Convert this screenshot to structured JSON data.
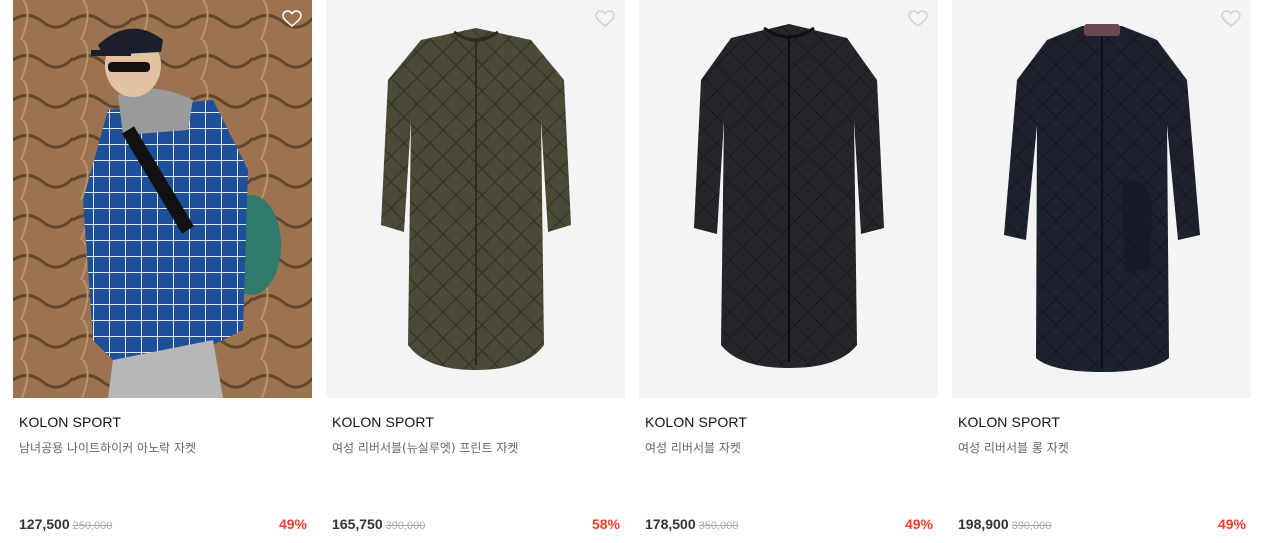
{
  "products": [
    {
      "brand": "KOLON SPORT",
      "name": "남녀공용 나이트하이커 아노락 자켓",
      "price": "127,500",
      "original_price": "250,000",
      "discount": "49%",
      "image": "model-photo",
      "wishlist_icon": "heart-outline-icon"
    },
    {
      "brand": "KOLON SPORT",
      "name": "여성 리버서블(뉴실루엣) 프린트 자켓",
      "price": "165,750",
      "original_price": "390,000",
      "discount": "58%",
      "image": "quilted-coat-olive",
      "wishlist_icon": "heart-outline-icon"
    },
    {
      "brand": "KOLON SPORT",
      "name": "여성 리버서블 자켓",
      "price": "178,500",
      "original_price": "350,000",
      "discount": "49%",
      "image": "quilted-coat-black",
      "wishlist_icon": "heart-outline-icon"
    },
    {
      "brand": "KOLON SPORT",
      "name": "여성 리버서블 롱 자켓",
      "price": "198,900",
      "original_price": "390,000",
      "discount": "49%",
      "image": "quilted-coat-navy",
      "wishlist_icon": "heart-outline-icon"
    }
  ],
  "colors": {
    "discount": "#ee3e2a",
    "olive": "#4a4a36",
    "black": "#24262b",
    "navy": "#1e2130"
  }
}
